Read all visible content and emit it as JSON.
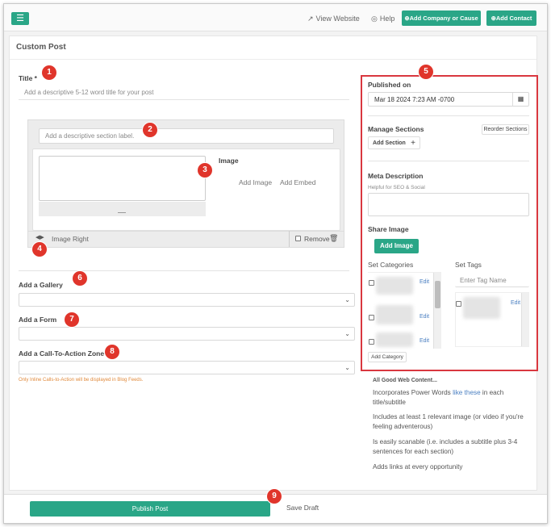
{
  "header": {
    "view_website": "View Website",
    "help": "Help",
    "add_company": "⊕Add Company or Cause",
    "add_contact": "⊕Add Contact"
  },
  "page_title": "Custom Post",
  "title_field": {
    "label": "Title *",
    "placeholder": "Add a descriptive 5-12 word title for your post"
  },
  "section": {
    "label_placeholder": "Add a descriptive section label.",
    "image_heading": "Image",
    "add_image": "Add Image",
    "add_embed": "Add Embed",
    "image_position": "Image Right",
    "remove": "Remove"
  },
  "gallery": {
    "label": "Add a Gallery"
  },
  "form": {
    "label": "Add a Form"
  },
  "cta": {
    "label": "Add a Call-To-Action Zone",
    "note": "Only Inline Calls-to-Action will be displayed in Blog Feeds."
  },
  "sidebar": {
    "published_on_label": "Published on",
    "published_on_value": "Mar 18 2024 7:23 AM -0700",
    "manage_sections": "Manage Sections",
    "reorder_sections": "Reorder Sections",
    "add_section": "Add Section",
    "meta_description": "Meta Description",
    "meta_hint": "Helpful for SEO & Social",
    "share_image": "Share Image",
    "add_image_btn": "Add Image",
    "set_categories": "Set Categories",
    "set_tags": "Set Tags",
    "tag_placeholder": "Enter Tag Name",
    "edit": "Edit",
    "add_category": "Add Category"
  },
  "tips": {
    "heading": "All Good Web Content...",
    "line1_pre": "Incorporates Power Words ",
    "line1_link": "like these",
    "line1_post": " in each title/subtitle",
    "line2": "Includes at least 1 relevant image (or video if you're feeling adventerous)",
    "line3": "Is easily scanable (i.e. includes a subtitle plus 3-4 sentences for each section)",
    "line4": "Adds links at every opportunity"
  },
  "footer": {
    "publish": "Publish Post",
    "save_draft": "Save Draft"
  },
  "badges": [
    "1",
    "2",
    "3",
    "4",
    "5",
    "6",
    "7",
    "8",
    "9"
  ],
  "colors": {
    "accent": "#2aa687",
    "badge": "#e0352b",
    "panel_border": "#d9373f",
    "link": "#4a7fc1",
    "note": "#e08a3c"
  }
}
